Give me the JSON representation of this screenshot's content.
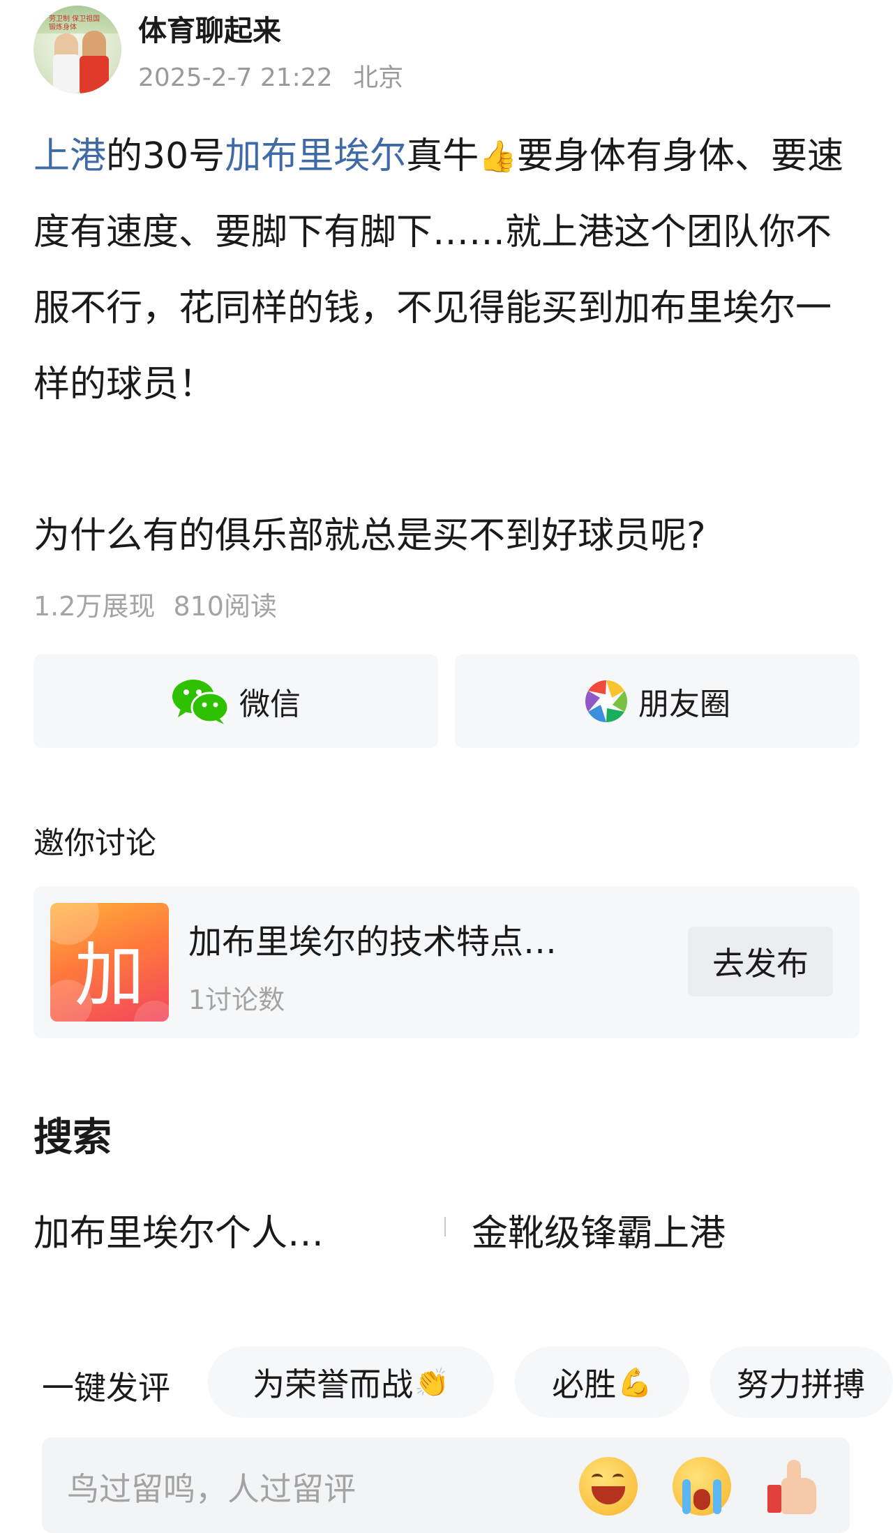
{
  "header": {
    "avatar_caption": "劳卫制 保卫祖国 锻炼身体",
    "username": "体育聊起来",
    "datetime": "2025-2-7 21:22",
    "location": "北京"
  },
  "post": {
    "segments": [
      {
        "text": "上港",
        "link": true
      },
      {
        "text": "的30号",
        "link": false
      },
      {
        "text": "加布里埃尔",
        "link": true
      },
      {
        "text": "真牛",
        "link": false
      },
      {
        "text": "👍",
        "link": false,
        "emoji": true
      },
      {
        "text": "要身体有身体、要速度有速度、要脚下有脚下……就上港这个团队你不服不行，花同样的钱，不见得能买到加布里埃尔一样的球员！",
        "link": false
      }
    ],
    "question": "为什么有的俱乐部就总是买不到好球员呢?",
    "impressions": "1.2万展现",
    "reads": "810阅读"
  },
  "share": {
    "wechat_label": "微信",
    "moments_label": "朋友圈"
  },
  "discuss": {
    "title": "邀你讨论",
    "topic_thumb_char": "加",
    "topic_title": "加布里埃尔的技术特点…",
    "topic_count": "1讨论数",
    "publish_label": "去发布"
  },
  "search": {
    "title": "搜索",
    "items": [
      "加布里埃尔个人…",
      "金靴级锋霸上港"
    ]
  },
  "quick_comments": {
    "label": "一键发评",
    "chips": [
      {
        "text": "为荣誉而战",
        "emoji": "👏"
      },
      {
        "text": "必胜",
        "emoji": "💪"
      },
      {
        "text": "努力拼搏",
        "emoji": ""
      }
    ]
  },
  "comment_bar": {
    "placeholder": "鸟过留鸣，人过留评"
  },
  "colors": {
    "link": "#3f6aa6",
    "muted": "#a3a3a3",
    "card_bg": "#f6f7f9",
    "wechat_green": "#2dc100"
  }
}
